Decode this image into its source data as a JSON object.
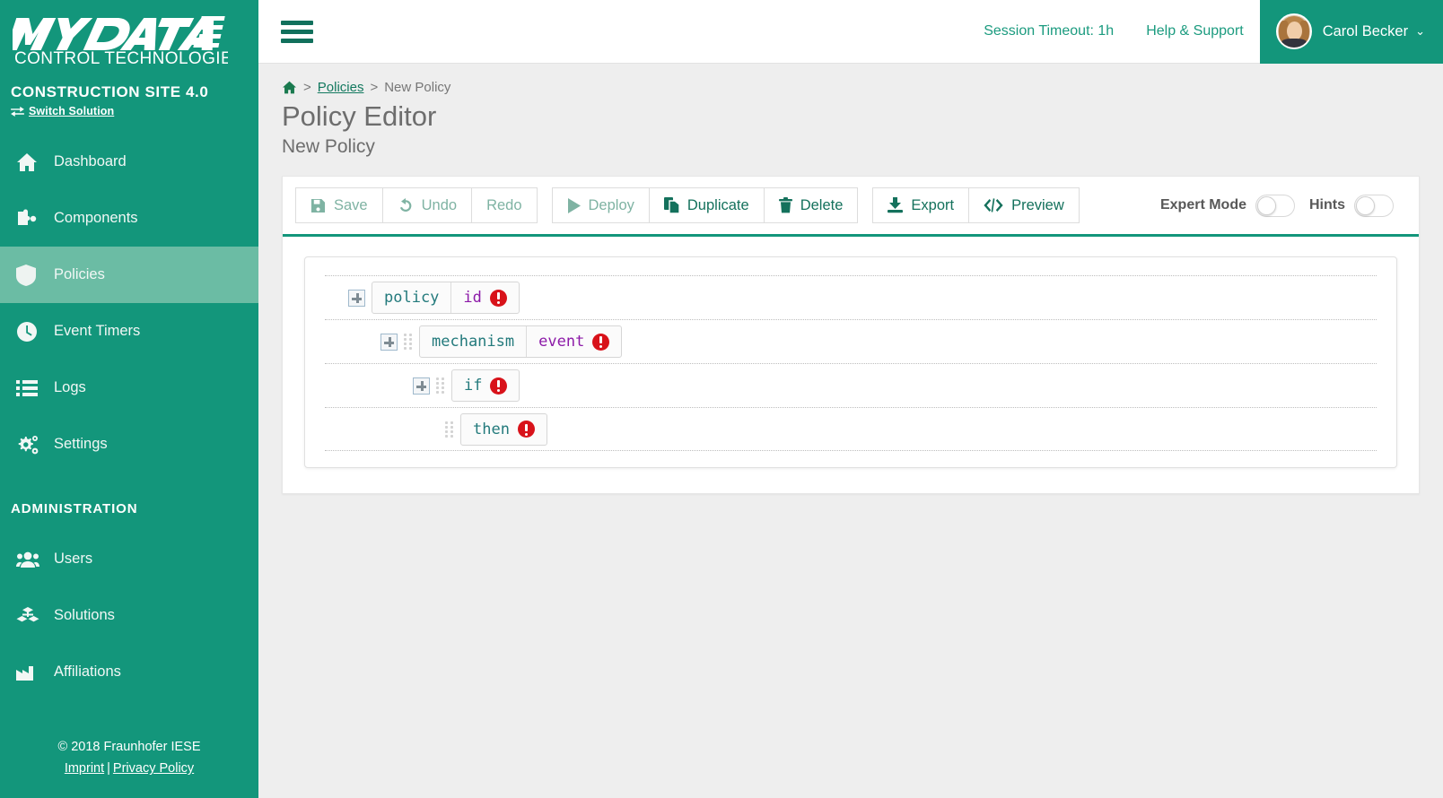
{
  "brand": {
    "logo_line1": "MYDATA",
    "logo_line2": "CONTROL TECHNOLOGIES",
    "solution_name": "CONSTRUCTION SITE 4.0",
    "switch_solution_label": "Switch Solution",
    "switch_icon": "exchange-arrows-icon"
  },
  "sidebar": {
    "items": [
      {
        "label": "Dashboard",
        "icon": "home-icon",
        "active": false
      },
      {
        "label": "Components",
        "icon": "puzzle-icon",
        "active": false
      },
      {
        "label": "Policies",
        "icon": "shield-icon",
        "active": true
      },
      {
        "label": "Event Timers",
        "icon": "clock-icon",
        "active": false
      },
      {
        "label": "Logs",
        "icon": "list-icon",
        "active": false
      },
      {
        "label": "Settings",
        "icon": "gears-icon",
        "active": false
      }
    ],
    "admin_section_label": "ADMINISTRATION",
    "admin_items": [
      {
        "label": "Users",
        "icon": "users-icon"
      },
      {
        "label": "Solutions",
        "icon": "cubes-icon"
      },
      {
        "label": "Affiliations",
        "icon": "factory-icon"
      }
    ],
    "footer": {
      "copyright": "© 2018 Fraunhofer IESE",
      "imprint": "Imprint",
      "separator": "|",
      "privacy": "Privacy Policy"
    }
  },
  "topbar": {
    "menu_icon": "hamburger-icon",
    "session_timeout": "Session Timeout: 1h",
    "help_support": "Help & Support",
    "user_name": "Carol Becker",
    "user_caret": "⌄",
    "avatar": "user-avatar"
  },
  "breadcrumb": {
    "home_icon": "home-icon",
    "sep1": ">",
    "policies": "Policies",
    "sep2": ">",
    "current": "New Policy"
  },
  "page": {
    "title": "Policy Editor",
    "subtitle": "New Policy"
  },
  "toolbar": {
    "groups": [
      [
        {
          "label": "Save",
          "icon": "floppy-disk-icon",
          "enabled": false
        },
        {
          "label": "Undo",
          "icon": "undo-arrow-icon",
          "enabled": false
        },
        {
          "label": "Redo",
          "icon": "none",
          "enabled": false
        }
      ],
      [
        {
          "label": "Deploy",
          "icon": "play-triangle-icon",
          "enabled": false
        },
        {
          "label": "Duplicate",
          "icon": "copy-icon",
          "enabled": true
        },
        {
          "label": "Delete",
          "icon": "trash-icon",
          "enabled": true
        }
      ],
      [
        {
          "label": "Export",
          "icon": "download-icon",
          "enabled": true
        },
        {
          "label": "Preview",
          "icon": "code-angle-icon",
          "enabled": true
        }
      ]
    ],
    "expert_mode_label": "Expert Mode",
    "expert_mode_on": false,
    "hints_label": "Hints",
    "hints_on": false
  },
  "tree": {
    "rows": [
      {
        "indent": 0,
        "expander": true,
        "grip": false,
        "segments": [
          {
            "text": "policy",
            "kind": "key"
          },
          {
            "text": "id",
            "kind": "attr",
            "error": true
          }
        ]
      },
      {
        "indent": 1,
        "expander": true,
        "grip": true,
        "segments": [
          {
            "text": "mechanism",
            "kind": "key"
          },
          {
            "text": "event",
            "kind": "attr",
            "error": true
          }
        ]
      },
      {
        "indent": 2,
        "expander": true,
        "grip": true,
        "segments": [
          {
            "text": "if",
            "kind": "key",
            "error": true
          }
        ]
      },
      {
        "indent": 3,
        "expander": false,
        "grip": true,
        "segments": [
          {
            "text": "then",
            "kind": "key",
            "error": true
          }
        ]
      }
    ],
    "error_badge_icon": "exclamation-circle-icon",
    "expander_icon": "plus-square-icon",
    "grip_icon": "drag-handle-icon"
  },
  "colors": {
    "brand_green": "#13967b",
    "brand_dark": "#11705c",
    "active_item": "#6bbca4",
    "error_red": "#d8121a",
    "page_bg": "#eeeeee",
    "key_teal": "#237a7c",
    "attr_purple": "#8c1aa8"
  }
}
